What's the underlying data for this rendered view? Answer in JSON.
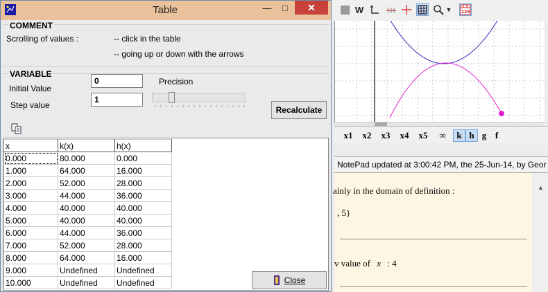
{
  "window": {
    "title": "Table",
    "minimize": "—",
    "maximize": "□",
    "close": "✕"
  },
  "comment": {
    "heading": "COMMENT",
    "label": "Scrolling of values :",
    "line1": "-- click in the table",
    "line2": "-- going up or down with the arrows"
  },
  "variable": {
    "heading": "VARIABLE",
    "initial_label": "Initial Value",
    "initial_value": "0",
    "step_label": "Step value",
    "step_value": "1",
    "precision_label": "Precision",
    "recalculate": "Recalculate"
  },
  "table": {
    "headers": [
      "x",
      "k(x)",
      "h(x)"
    ],
    "rows": [
      [
        "0.000",
        "80.000",
        "0.000"
      ],
      [
        "1.000",
        "64.000",
        "16.000"
      ],
      [
        "2.000",
        "52.000",
        "28.000"
      ],
      [
        "3.000",
        "44.000",
        "36.000"
      ],
      [
        "4.000",
        "40.000",
        "40.000"
      ],
      [
        "5.000",
        "40.000",
        "40.000"
      ],
      [
        "6.000",
        "44.000",
        "36.000"
      ],
      [
        "7.000",
        "52.000",
        "28.000"
      ],
      [
        "8.000",
        "64.000",
        "16.000"
      ],
      [
        "9.000",
        "Undefined",
        "Undefined"
      ],
      [
        "10.000",
        "Undefined",
        "Undefined"
      ]
    ]
  },
  "close_button": "Close",
  "background": {
    "toolbar": {
      "w_label": "W"
    },
    "function_bar": [
      "x1",
      "x2",
      "x3",
      "x4",
      "x5",
      "∞",
      "k",
      "h",
      "g",
      "f"
    ],
    "function_bar_selected": [
      "k",
      "h"
    ],
    "notepad_status": "NotePad updated at 3:00:42 PM, the 25-Jun-14, by Geor",
    "notepad_line1": "ainly in the domain of definition :",
    "notepad_line2": ", 5}",
    "notepad_line3": "v value of",
    "notepad_var": "x",
    "notepad_line3_end": ":  4",
    "colors": {
      "curve_k": "#2b2bb5",
      "curve_h": "#e020d0"
    }
  }
}
